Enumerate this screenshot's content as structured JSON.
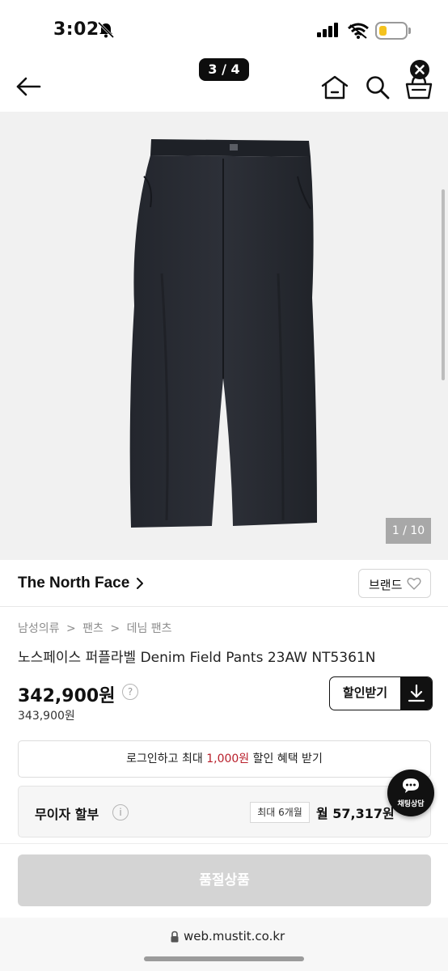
{
  "status_bar": {
    "time": "3:02"
  },
  "header": {
    "page_indicator": "3 / 4"
  },
  "gallery": {
    "counter": "1 / 10"
  },
  "brand": {
    "name": "The North Face",
    "button_label": "브랜드"
  },
  "breadcrumb": [
    "남성의류",
    "팬츠",
    "데님 팬츠"
  ],
  "breadcrumb_separator": ">",
  "product": {
    "title": "노스페이스 퍼플라벨 Denim Field Pants 23AW NT5361N",
    "price": "342,900원",
    "original_price": "343,900원",
    "help_glyph": "?",
    "coupon_label": "할인받기"
  },
  "login_banner": {
    "before": "로그인하고 최대 ",
    "highlight": "1,000원",
    "after": " 할인 혜택 받기",
    "highlight_color": "#b81e2a"
  },
  "installment": {
    "label": "무이자 할부",
    "info_glyph": "i",
    "max_months": "최대 6개월",
    "monthly": "월 57,317원"
  },
  "chat": {
    "label": "채팅상담"
  },
  "cta": {
    "label": "품절상품"
  },
  "browser": {
    "url": "web.mustit.co.kr"
  },
  "icons": {
    "back": "arrow-left-icon",
    "home": "home-icon",
    "search": "search-icon",
    "cart": "cart-icon",
    "close": "close-icon",
    "heart": "heart-icon",
    "download": "download-icon",
    "chat": "chat-icon",
    "lock": "lock-icon"
  }
}
